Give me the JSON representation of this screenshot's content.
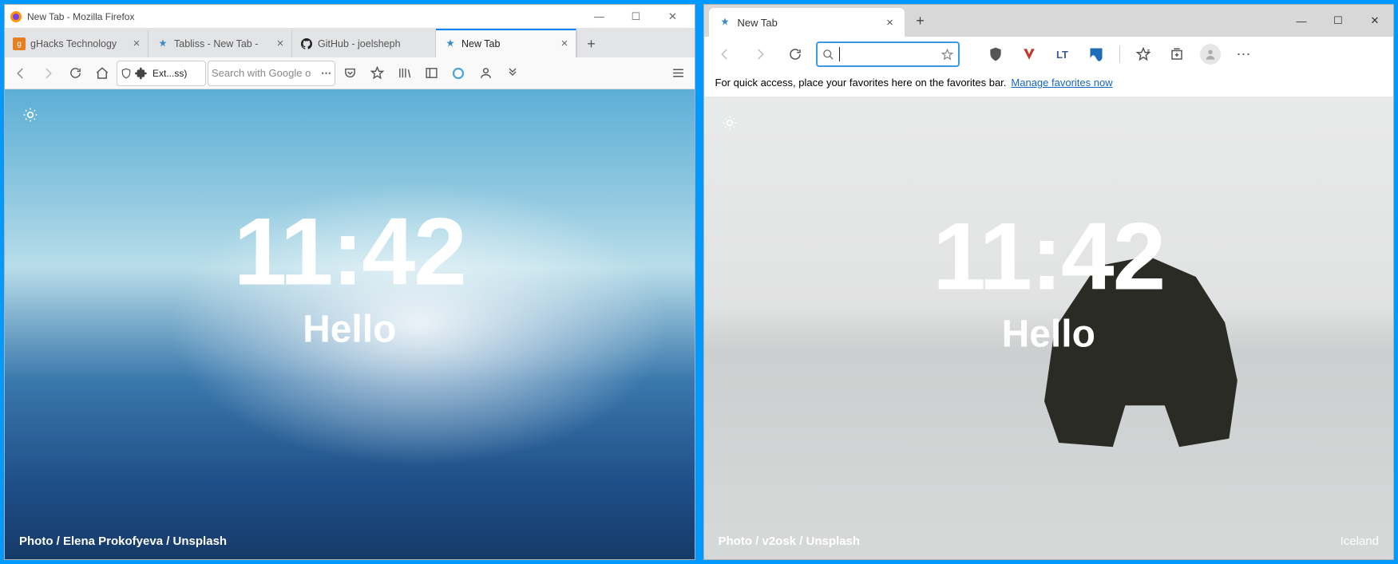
{
  "firefox": {
    "window_title": "New Tab - Mozilla Firefox",
    "tabs": [
      {
        "label": "gHacks Technology"
      },
      {
        "label": "Tabliss - New Tab -"
      },
      {
        "label": "GitHub - joelsheph"
      },
      {
        "label": "New Tab"
      }
    ],
    "urlbox_text": "Ext...ss)",
    "search_placeholder": "Search with Google o",
    "clock": "11:42",
    "greeting": "Hello",
    "photo_credit": "Photo / Elena Prokofyeva / Unsplash"
  },
  "edge": {
    "tab_label": "New Tab",
    "favbar_hint": "For quick access, place your favorites here on the favorites bar.",
    "favbar_link": "Manage favorites now",
    "clock": "11:42",
    "greeting": "Hello",
    "photo_credit": "Photo / v2osk / Unsplash",
    "location": "Iceland"
  },
  "icons": {
    "minimize": "—",
    "maximize": "☐",
    "close": "✕",
    "plus": "+",
    "dots": "⋯",
    "menu3": "⋯"
  }
}
